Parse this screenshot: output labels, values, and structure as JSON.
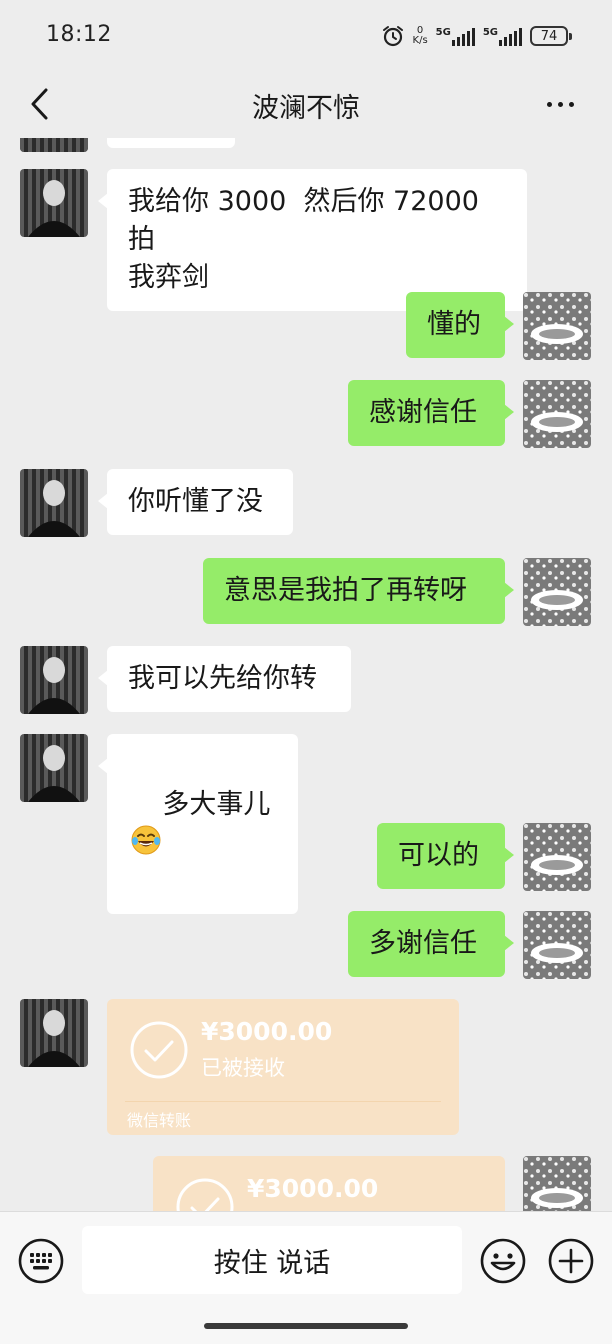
{
  "status_bar": {
    "time": "18:12",
    "net_speed_value": "0",
    "net_speed_unit": "K/s",
    "sim1_label": "5G",
    "sim2_label": "5G",
    "battery": "74",
    "icons": [
      "alarm-icon",
      "net-speed",
      "signal-icon",
      "signal-icon",
      "battery-icon"
    ]
  },
  "nav": {
    "title": "波澜不惊",
    "back_icon": "chevron-left-icon",
    "more_icon": "more-dots-icon"
  },
  "messages": [
    {
      "side": "left",
      "type": "text",
      "text": "我给你 3000  然后你 72000 拍\n我弈剑"
    },
    {
      "side": "right",
      "type": "text",
      "text": "懂的"
    },
    {
      "side": "right",
      "type": "text",
      "text": "感谢信任"
    },
    {
      "side": "left",
      "type": "text",
      "text": "你听懂了没"
    },
    {
      "side": "right",
      "type": "text",
      "text": "意思是我拍了再转呀"
    },
    {
      "side": "left",
      "type": "text",
      "text": "我可以先给你转"
    },
    {
      "side": "left",
      "type": "text",
      "text": "多大事儿",
      "emoji": "laughing-tears-emoji"
    },
    {
      "side": "right",
      "type": "text",
      "text": "可以的"
    },
    {
      "side": "right",
      "type": "text",
      "text": "多谢信任"
    },
    {
      "side": "left",
      "type": "transfer",
      "amount": "¥3000.00",
      "status": "已被接收",
      "footer": "微信转账"
    },
    {
      "side": "right",
      "type": "transfer",
      "amount": "¥3000.00"
    }
  ],
  "input_bar": {
    "keyboard_icon": "keyboard-icon",
    "voice_label": "按住 说话",
    "emoji_icon": "smiley-icon",
    "plus_icon": "plus-icon"
  },
  "colors": {
    "background": "#ededed",
    "bubble_green": "#95ec69",
    "bubble_white": "#ffffff",
    "transfer_card": "#f8e2c6"
  }
}
